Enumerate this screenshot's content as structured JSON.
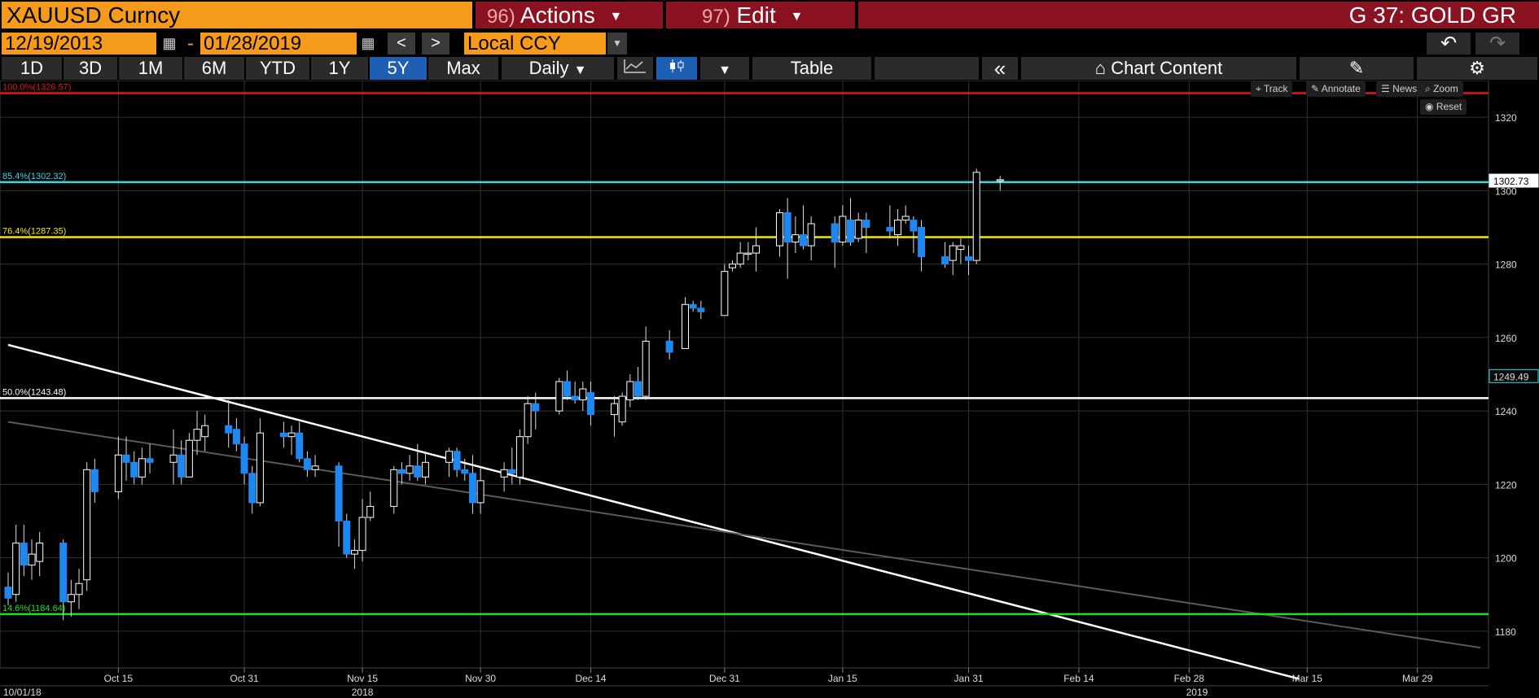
{
  "header": {
    "ticker": "XAUUSD Curncy",
    "actions_num": "96)",
    "actions_label": "Actions",
    "edit_num": "97)",
    "edit_label": "Edit",
    "page_title": "G 37: GOLD GR"
  },
  "date_range": {
    "start": "12/19/2013",
    "separator": "-",
    "end": "01/28/2019",
    "prev": "<",
    "next": ">",
    "currency": "Local CCY"
  },
  "toolbar": {
    "periods": [
      "1D",
      "3D",
      "1M",
      "6M",
      "YTD",
      "1Y",
      "5Y",
      "Max"
    ],
    "active_period": "5Y",
    "frequency": "Daily",
    "table_label": "Table",
    "collapse_label": "«",
    "chart_content_label": "Chart Content"
  },
  "chart_tools": {
    "track": "Track",
    "annotate": "Annotate",
    "news": "News",
    "zoom": "Zoom",
    "reset": "Reset"
  },
  "colors": {
    "bull": "#ffffff",
    "bear": "#1e88f2",
    "red_level": "#e01818",
    "cyan_level": "#3fd6e0",
    "yellow_level": "#f2e614",
    "white_level": "#ffffff",
    "green_level": "#1fe01f",
    "grid": "#333333",
    "accent_orange": "#f59a1b",
    "menu_red": "#8b1221"
  },
  "chart_data": {
    "type": "candlestick",
    "ylim": [
      1170,
      1330
    ],
    "y_ticks": [
      1180,
      1200,
      1220,
      1240,
      1260,
      1280,
      1300,
      1320
    ],
    "x_range": [
      "2018-10-01",
      "2019-04-06"
    ],
    "x_ticks": [
      {
        "date": "2018-10-15",
        "label": "Oct 15"
      },
      {
        "date": "2018-10-31",
        "label": "Oct 31"
      },
      {
        "date": "2018-11-15",
        "label": "Nov 15"
      },
      {
        "date": "2018-11-30",
        "label": "Nov 30"
      },
      {
        "date": "2018-12-14",
        "label": "Dec 14"
      },
      {
        "date": "2018-12-31",
        "label": "Dec 31"
      },
      {
        "date": "2019-01-15",
        "label": "Jan 15"
      },
      {
        "date": "2019-01-31",
        "label": "Jan 31"
      },
      {
        "date": "2019-02-14",
        "label": "Feb 14"
      },
      {
        "date": "2019-02-28",
        "label": "Feb 28"
      },
      {
        "date": "2019-03-15",
        "label": "Mar 15"
      },
      {
        "date": "2019-03-29",
        "label": "Mar 29"
      }
    ],
    "year_labels": [
      {
        "date": "2018-10-01",
        "label": "10/01/18"
      },
      {
        "date": "2018-11-15",
        "label": "2018"
      },
      {
        "date": "2019-03-01",
        "label": "2019"
      }
    ],
    "price_labels": [
      {
        "value": 1302.73,
        "label": "1302.73"
      },
      {
        "value": 1249.49,
        "label": "1249.49"
      }
    ],
    "levels": [
      {
        "label": "100.0%(1326.57)",
        "value": 1326.57,
        "color": "#e01818"
      },
      {
        "label": "85.4%(1302.32)",
        "value": 1302.32,
        "color": "#3fd6e0"
      },
      {
        "label": "76.4%(1287.35)",
        "value": 1287.35,
        "color": "#f2e614"
      },
      {
        "label": "50.0%(1243.48)",
        "value": 1243.48,
        "color": "#ffffff"
      },
      {
        "label": "14.6%(1184.64)",
        "value": 1184.64,
        "color": "#1fe01f"
      }
    ],
    "trendlines": [
      {
        "from": [
          "2018-10-01",
          1258
        ],
        "to": [
          "2019-03-14",
          1167
        ],
        "color": "#ffffff",
        "width": 2.5
      },
      {
        "from": [
          "2018-10-01",
          1237
        ],
        "to": [
          "2019-04-06",
          1175.5
        ],
        "color": "#5a5a5a",
        "width": 2
      }
    ],
    "candles": [
      {
        "date": "2018-10-01",
        "o": 1192,
        "h": 1196,
        "l": 1187,
        "c": 1189
      },
      {
        "date": "2018-10-02",
        "o": 1190,
        "h": 1209,
        "l": 1188,
        "c": 1204
      },
      {
        "date": "2018-10-03",
        "o": 1204,
        "h": 1209,
        "l": 1195,
        "c": 1198
      },
      {
        "date": "2018-10-04",
        "o": 1198,
        "h": 1205,
        "l": 1194,
        "c": 1201
      },
      {
        "date": "2018-10-05",
        "o": 1199,
        "h": 1207,
        "l": 1195,
        "c": 1204
      },
      {
        "date": "2018-10-08",
        "o": 1204,
        "h": 1205,
        "l": 1183,
        "c": 1188
      },
      {
        "date": "2018-10-09",
        "o": 1188,
        "h": 1194,
        "l": 1184,
        "c": 1190
      },
      {
        "date": "2018-10-10",
        "o": 1190,
        "h": 1197,
        "l": 1186,
        "c": 1193
      },
      {
        "date": "2018-10-11",
        "o": 1194,
        "h": 1226,
        "l": 1191,
        "c": 1224
      },
      {
        "date": "2018-10-12",
        "o": 1224,
        "h": 1227,
        "l": 1215,
        "c": 1218
      },
      {
        "date": "2018-10-15",
        "o": 1218,
        "h": 1233,
        "l": 1216,
        "c": 1228
      },
      {
        "date": "2018-10-16",
        "o": 1228,
        "h": 1233,
        "l": 1221,
        "c": 1226
      },
      {
        "date": "2018-10-17",
        "o": 1226,
        "h": 1229,
        "l": 1220,
        "c": 1222
      },
      {
        "date": "2018-10-18",
        "o": 1222,
        "h": 1230,
        "l": 1220,
        "c": 1227
      },
      {
        "date": "2018-10-19",
        "o": 1227,
        "h": 1231,
        "l": 1223,
        "c": 1226
      },
      {
        "date": "2018-10-22",
        "o": 1226,
        "h": 1235,
        "l": 1220,
        "c": 1228
      },
      {
        "date": "2018-10-23",
        "o": 1228,
        "h": 1232,
        "l": 1220,
        "c": 1222
      },
      {
        "date": "2018-10-24",
        "o": 1222,
        "h": 1234,
        "l": 1222,
        "c": 1232
      },
      {
        "date": "2018-10-25",
        "o": 1232,
        "h": 1240,
        "l": 1228,
        "c": 1235
      },
      {
        "date": "2018-10-26",
        "o": 1233,
        "h": 1239,
        "l": 1229,
        "c": 1236
      },
      {
        "date": "2018-10-29",
        "o": 1236,
        "h": 1243,
        "l": 1230,
        "c": 1234
      },
      {
        "date": "2018-10-30",
        "o": 1235,
        "h": 1238,
        "l": 1229,
        "c": 1231
      },
      {
        "date": "2018-10-31",
        "o": 1231,
        "h": 1233,
        "l": 1220,
        "c": 1223
      },
      {
        "date": "2018-11-01",
        "o": 1223,
        "h": 1225,
        "l": 1212,
        "c": 1215
      },
      {
        "date": "2018-11-02",
        "o": 1215,
        "h": 1238,
        "l": 1214,
        "c": 1234
      },
      {
        "date": "2018-11-05",
        "o": 1234,
        "h": 1237,
        "l": 1230,
        "c": 1233
      },
      {
        "date": "2018-11-06",
        "o": 1233,
        "h": 1236,
        "l": 1228,
        "c": 1234
      },
      {
        "date": "2018-11-07",
        "o": 1234,
        "h": 1237,
        "l": 1226,
        "c": 1227
      },
      {
        "date": "2018-11-08",
        "o": 1227,
        "h": 1229,
        "l": 1222,
        "c": 1224
      },
      {
        "date": "2018-11-09",
        "o": 1224,
        "h": 1228,
        "l": 1222,
        "c": 1225
      },
      {
        "date": "2018-11-12",
        "o": 1225,
        "h": 1226,
        "l": 1203,
        "c": 1210
      },
      {
        "date": "2018-11-13",
        "o": 1210,
        "h": 1212,
        "l": 1200,
        "c": 1201
      },
      {
        "date": "2018-11-14",
        "o": 1201,
        "h": 1205,
        "l": 1197,
        "c": 1202
      },
      {
        "date": "2018-11-15",
        "o": 1202,
        "h": 1216,
        "l": 1199,
        "c": 1211
      },
      {
        "date": "2018-11-16",
        "o": 1211,
        "h": 1218,
        "l": 1210,
        "c": 1214
      },
      {
        "date": "2018-11-19",
        "o": 1214,
        "h": 1225,
        "l": 1212,
        "c": 1224
      },
      {
        "date": "2018-11-20",
        "o": 1224,
        "h": 1226,
        "l": 1220,
        "c": 1223
      },
      {
        "date": "2018-11-21",
        "o": 1223,
        "h": 1228,
        "l": 1221,
        "c": 1225
      },
      {
        "date": "2018-11-22",
        "o": 1225,
        "h": 1231,
        "l": 1221,
        "c": 1222
      },
      {
        "date": "2018-11-23",
        "o": 1222,
        "h": 1229,
        "l": 1220,
        "c": 1226
      },
      {
        "date": "2018-11-26",
        "o": 1226,
        "h": 1230,
        "l": 1222,
        "c": 1229
      },
      {
        "date": "2018-11-27",
        "o": 1229,
        "h": 1230,
        "l": 1222,
        "c": 1224
      },
      {
        "date": "2018-11-28",
        "o": 1224,
        "h": 1227,
        "l": 1221,
        "c": 1223
      },
      {
        "date": "2018-11-29",
        "o": 1223,
        "h": 1228,
        "l": 1212,
        "c": 1215
      },
      {
        "date": "2018-11-30",
        "o": 1215,
        "h": 1225,
        "l": 1212,
        "c": 1221
      },
      {
        "date": "2018-12-03",
        "o": 1222,
        "h": 1226,
        "l": 1218,
        "c": 1224
      },
      {
        "date": "2018-12-04",
        "o": 1224,
        "h": 1230,
        "l": 1220,
        "c": 1223
      },
      {
        "date": "2018-12-05",
        "o": 1222,
        "h": 1235,
        "l": 1220,
        "c": 1233
      },
      {
        "date": "2018-12-06",
        "o": 1233,
        "h": 1244,
        "l": 1231,
        "c": 1242
      },
      {
        "date": "2018-12-07",
        "o": 1242,
        "h": 1245,
        "l": 1235,
        "c": 1240
      },
      {
        "date": "2018-12-10",
        "o": 1240,
        "h": 1249,
        "l": 1239,
        "c": 1248
      },
      {
        "date": "2018-12-11",
        "o": 1248,
        "h": 1251,
        "l": 1243,
        "c": 1244
      },
      {
        "date": "2018-12-12",
        "o": 1244,
        "h": 1248,
        "l": 1242,
        "c": 1243
      },
      {
        "date": "2018-12-13",
        "o": 1243,
        "h": 1248,
        "l": 1240,
        "c": 1246
      },
      {
        "date": "2018-12-14",
        "o": 1245,
        "h": 1248,
        "l": 1236,
        "c": 1239
      },
      {
        "date": "2018-12-17",
        "o": 1239,
        "h": 1244,
        "l": 1233,
        "c": 1242
      },
      {
        "date": "2018-12-18",
        "o": 1237,
        "h": 1245,
        "l": 1236,
        "c": 1244
      },
      {
        "date": "2018-12-19",
        "o": 1243,
        "h": 1250,
        "l": 1241,
        "c": 1248
      },
      {
        "date": "2018-12-20",
        "o": 1248,
        "h": 1252,
        "l": 1243,
        "c": 1244
      },
      {
        "date": "2018-12-21",
        "o": 1244,
        "h": 1263,
        "l": 1243,
        "c": 1259
      },
      {
        "date": "2018-12-24",
        "o": 1259,
        "h": 1262,
        "l": 1254,
        "c": 1256
      },
      {
        "date": "2018-12-26",
        "o": 1257,
        "h": 1271,
        "l": 1257,
        "c": 1269
      },
      {
        "date": "2018-12-27",
        "o": 1269,
        "h": 1270,
        "l": 1267,
        "c": 1268
      },
      {
        "date": "2018-12-28",
        "o": 1268,
        "h": 1270,
        "l": 1265,
        "c": 1267
      },
      {
        "date": "2018-12-31",
        "o": 1266,
        "h": 1280,
        "l": 1266,
        "c": 1278
      },
      {
        "date": "2019-01-01",
        "o": 1279,
        "h": 1281,
        "l": 1278,
        "c": 1280
      },
      {
        "date": "2019-01-02",
        "o": 1280,
        "h": 1286,
        "l": 1279,
        "c": 1283
      },
      {
        "date": "2019-01-03",
        "o": 1283,
        "h": 1286,
        "l": 1281,
        "c": 1283
      },
      {
        "date": "2019-01-04",
        "o": 1283,
        "h": 1290,
        "l": 1278,
        "c": 1285
      },
      {
        "date": "2019-01-07",
        "o": 1285,
        "h": 1295,
        "l": 1282,
        "c": 1294
      },
      {
        "date": "2019-01-08",
        "o": 1294,
        "h": 1298,
        "l": 1276,
        "c": 1286
      },
      {
        "date": "2019-01-09",
        "o": 1286,
        "h": 1293,
        "l": 1283,
        "c": 1288
      },
      {
        "date": "2019-01-10",
        "o": 1288,
        "h": 1296,
        "l": 1284,
        "c": 1285
      },
      {
        "date": "2019-01-11",
        "o": 1285,
        "h": 1293,
        "l": 1281,
        "c": 1291
      },
      {
        "date": "2019-01-14",
        "o": 1291,
        "h": 1293,
        "l": 1279,
        "c": 1286
      },
      {
        "date": "2019-01-15",
        "o": 1286,
        "h": 1296,
        "l": 1285,
        "c": 1293
      },
      {
        "date": "2019-01-16",
        "o": 1292,
        "h": 1298,
        "l": 1285,
        "c": 1286
      },
      {
        "date": "2019-01-17",
        "o": 1287,
        "h": 1294,
        "l": 1286,
        "c": 1292
      },
      {
        "date": "2019-01-18",
        "o": 1292,
        "h": 1294,
        "l": 1283,
        "c": 1290
      },
      {
        "date": "2019-01-21",
        "o": 1290,
        "h": 1296,
        "l": 1287,
        "c": 1289
      },
      {
        "date": "2019-01-22",
        "o": 1288,
        "h": 1295,
        "l": 1285,
        "c": 1292
      },
      {
        "date": "2019-01-23",
        "o": 1292,
        "h": 1296,
        "l": 1291,
        "c": 1293
      },
      {
        "date": "2019-01-24",
        "o": 1292,
        "h": 1293,
        "l": 1283,
        "c": 1289
      },
      {
        "date": "2019-01-25",
        "o": 1290,
        "h": 1292,
        "l": 1278,
        "c": 1282
      },
      {
        "date": "2019-01-28",
        "o": 1282,
        "h": 1286,
        "l": 1279,
        "c": 1280
      },
      {
        "date": "2019-01-29",
        "o": 1281,
        "h": 1286,
        "l": 1277,
        "c": 1285
      },
      {
        "date": "2019-01-30",
        "o": 1284,
        "h": 1287,
        "l": 1280,
        "c": 1285
      },
      {
        "date": "2019-01-31",
        "o": 1282,
        "h": 1285,
        "l": 1277,
        "c": 1281
      },
      {
        "date": "2019-02-01",
        "o": 1281,
        "h": 1306,
        "l": 1280,
        "c": 1305
      },
      {
        "date": "2019-02-04",
        "o": 1303,
        "h": 1304,
        "l": 1300,
        "c": 1303
      }
    ]
  }
}
